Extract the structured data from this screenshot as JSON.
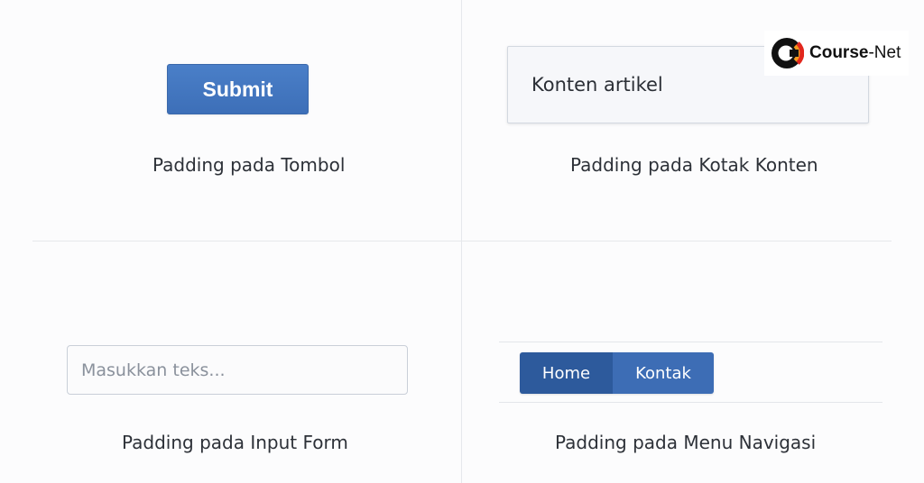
{
  "brand": {
    "name_bold": "Course",
    "name_rest": "-Net",
    "icon": "course-net-logo-icon"
  },
  "panels": {
    "button_demo": {
      "button_label": "Submit",
      "caption": "Padding pada Tombol"
    },
    "content_demo": {
      "box_text": "Konten artikel",
      "caption": "Padding pada Kotak Konten"
    },
    "input_demo": {
      "placeholder": "Masukkan teks...",
      "value": "",
      "caption": "Padding pada Input Form"
    },
    "nav_demo": {
      "items": [
        {
          "label": "Home",
          "active": true
        },
        {
          "label": "Kontak",
          "active": false
        }
      ],
      "caption": "Padding pada Menu Navigasi"
    }
  },
  "colors": {
    "button_blue": "#4277c1",
    "nav_active": "#2d5a9c",
    "nav_default": "#3d6db5",
    "logo_ring_orange": "#f39a1e",
    "logo_ring_red": "#e2271d"
  }
}
